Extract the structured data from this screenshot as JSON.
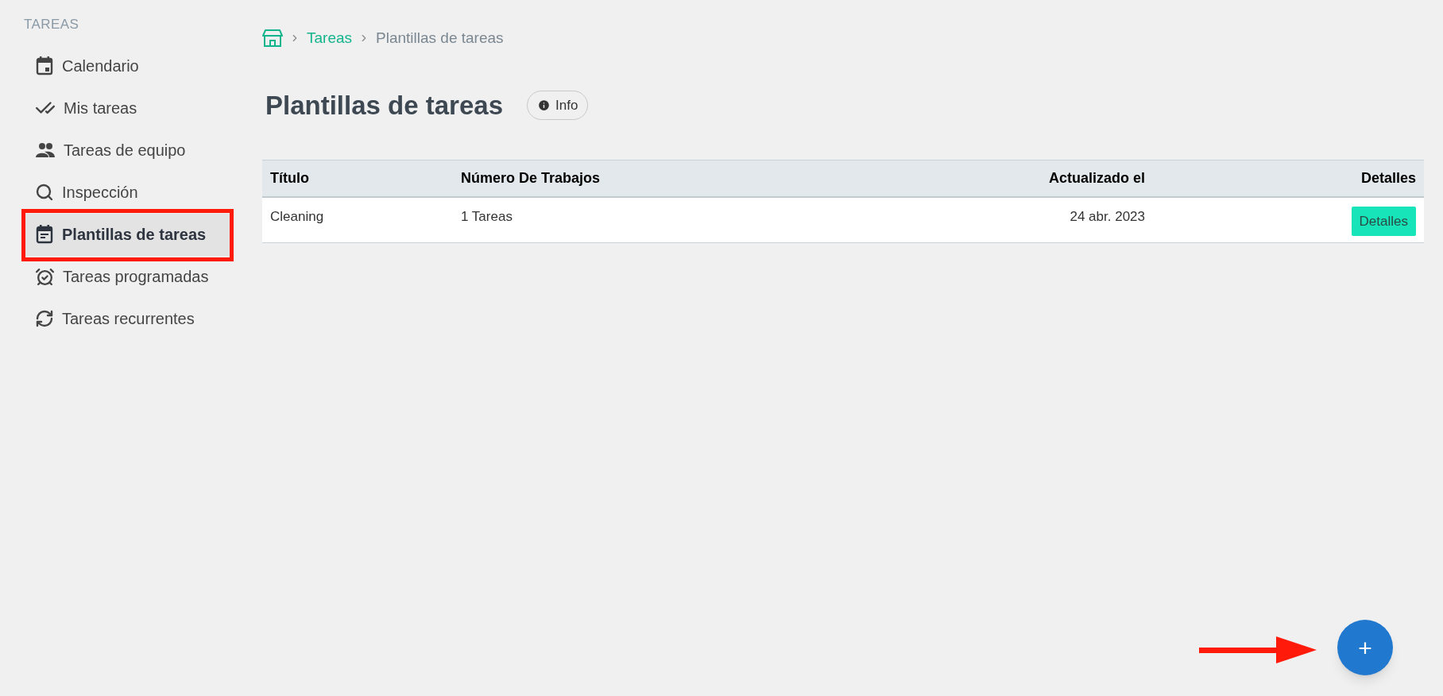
{
  "sidebar": {
    "section_title": "TAREAS",
    "items": [
      {
        "label": "Calendario",
        "selected": false
      },
      {
        "label": "Mis tareas",
        "selected": false
      },
      {
        "label": "Tareas de equipo",
        "selected": false
      },
      {
        "label": "Inspección",
        "selected": false
      },
      {
        "label": "Plantillas de tareas",
        "selected": true
      },
      {
        "label": "Tareas programadas",
        "selected": false
      },
      {
        "label": "Tareas recurrentes",
        "selected": false
      }
    ]
  },
  "breadcrumb": {
    "items": [
      "Tareas",
      "Plantillas de tareas"
    ]
  },
  "page": {
    "title": "Plantillas de tareas",
    "info_button": "Info"
  },
  "table": {
    "columns": [
      "Título",
      "Número De Trabajos",
      "Actualizado el",
      "Detalles"
    ],
    "rows": [
      {
        "cells": [
          "Cleaning",
          "1 Tareas",
          "24 abr. 2023"
        ],
        "button": "Detalles"
      }
    ]
  },
  "fab": {
    "label": "+"
  }
}
